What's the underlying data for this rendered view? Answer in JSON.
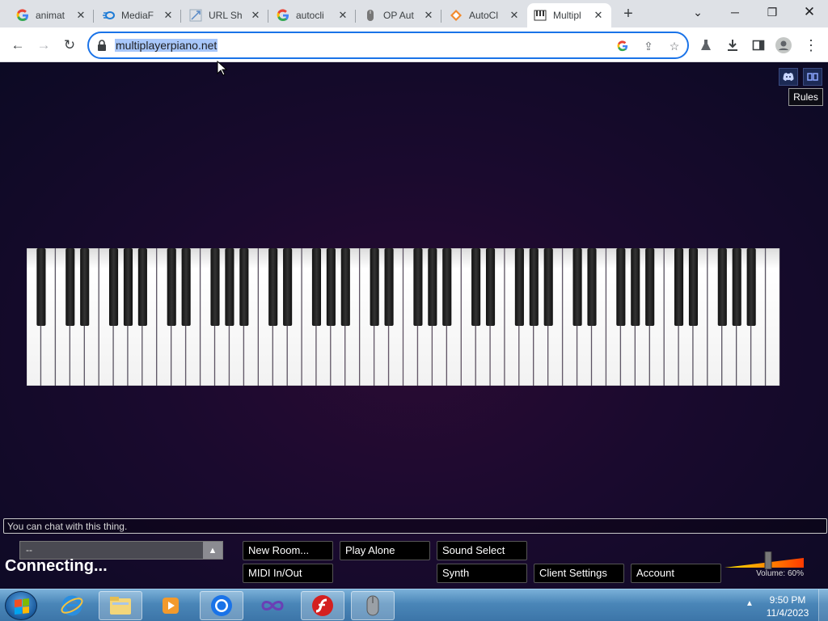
{
  "browser": {
    "tabs": [
      {
        "title": "animat",
        "icon": "google-icon",
        "active": false
      },
      {
        "title": "MediaF",
        "icon": "mediafire-icon",
        "active": false
      },
      {
        "title": "URL Sh",
        "icon": "url-shortener-icon",
        "active": false
      },
      {
        "title": "autocli",
        "icon": "google-icon",
        "active": false
      },
      {
        "title": "OP Aut",
        "icon": "mouse-icon",
        "active": false
      },
      {
        "title": "AutoCl",
        "icon": "autoclicker-icon",
        "active": false
      },
      {
        "title": "Multipl",
        "icon": "piano-icon",
        "active": true
      }
    ],
    "url": "multiplayerpiano.net"
  },
  "page": {
    "rules_label": "Rules",
    "chat_placeholder": "You can chat with this thing.",
    "room_select_value": "--",
    "status": "Connecting...",
    "buttons": {
      "new_room": "New Room...",
      "play_alone": "Play Alone",
      "sound_select": "Sound Select",
      "midi": "MIDI In/Out",
      "synth": "Synth",
      "client_settings": "Client Settings",
      "account": "Account"
    },
    "volume_label": "Volume: 60%",
    "volume_level": 0.6,
    "piano": {
      "white_keys": 52,
      "lowest_note": "A0",
      "highest_note": "C8"
    }
  },
  "taskbar": {
    "apps": [
      "windows-explorer-icon",
      "internet-explorer-icon",
      "file-explorer-icon",
      "media-player-icon",
      "chrome-icon",
      "visual-studio-icon",
      "flash-icon",
      "mouse-app-icon"
    ],
    "time": "9:50 PM",
    "date": "11/4/2023"
  },
  "colors": {
    "accent": "#1a73e8",
    "page_bg": "#1a0a2e",
    "url_highlight": "#a8c7fa"
  }
}
